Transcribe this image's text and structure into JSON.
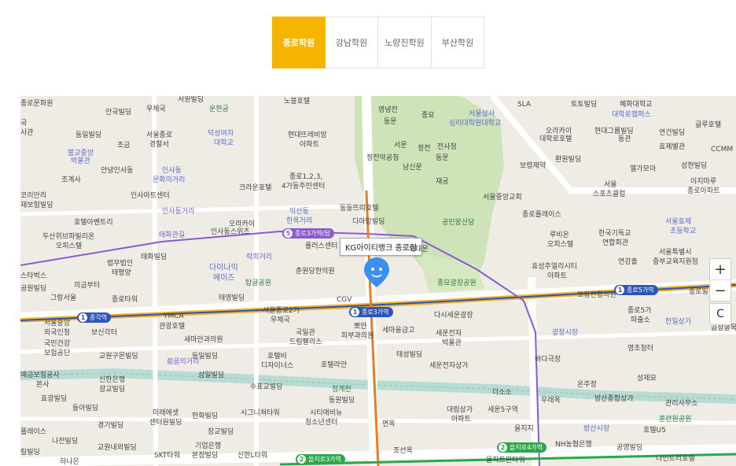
{
  "tabs": [
    {
      "label": "종로학원",
      "active": true
    },
    {
      "label": "강남학원",
      "active": false
    },
    {
      "label": "노량진학원",
      "active": false
    },
    {
      "label": "부산학원",
      "active": false
    }
  ],
  "map": {
    "pin_label": "KG아이티뱅크 종로점",
    "zoom_in": "+",
    "zoom_out": "−",
    "reset": "C",
    "stations": {
      "jonggak": "종각역",
      "jongno3ga": "종로3가역",
      "jongno5ga": "종로5가역",
      "jongno3ga_purple": "종로3가역(탑",
      "euljiro4ga": "을지로4가역",
      "euljiro3ga": "을지로3가역"
    },
    "labels": {
      "l1": "종로문화원",
      "l2": "안국빌딩",
      "l3": "우체국",
      "l4": "서원빌딩",
      "l5": "운현궁",
      "l6": "노블호텔",
      "l7": "영녕전",
      "l8": "동문",
      "l9": "종묘",
      "l10": "서울상사",
      "l11": "심리대학원대학교",
      "l12": "SLA",
      "l13": "토토빌딩",
      "l14": "혜화대학교",
      "l15": "대학로캠퍼스",
      "l16": "국",
      "l17": "사관",
      "l18": "동일빌딩",
      "l19": "조금",
      "l20": "서울종로",
      "l21": "경찰서",
      "l22": "덕성여자",
      "l23": "대학교",
      "l24": "현대뜨레비앙",
      "l25": "아파트",
      "l26": "서문",
      "l27": "정전",
      "l28": "전사청",
      "l29": "정전악공청",
      "l30": "동문",
      "l31": "남신문",
      "l32": "오라카이",
      "l33": "대학로호텔",
      "l34": "현대그룹빌딩",
      "l35": "동관",
      "l36": "연건빌딩",
      "l37": "글루호텔",
      "l38": "효제별관",
      "l39": "CCMM",
      "l40": "불교중앙",
      "l41": "박물관",
      "l42": "조계사",
      "l43": "안녕인사동",
      "l44": "인사동",
      "l45": "문화의거리",
      "l46": "종로1,2,3,",
      "l47": "4가동주민센터",
      "l48": "재궁",
      "l49": "보령제약",
      "l50": "환원빌딩",
      "l51": "엘가모아",
      "l52": "성현빌딩",
      "l53": "코리안리",
      "l54": "재보험빌딩",
      "l55": "인사아트센터",
      "l56": "크라운호텔",
      "l57": "서울",
      "l58": "스포츠클럽",
      "l59": "이지마루",
      "l60": "종로아파트",
      "l61": "인사동거리",
      "l62": "호텔아벤트리",
      "l63": "익선동",
      "l64": "한옥거리",
      "l65": "동동뜨띠호텔",
      "l66": "서울중앙교회",
      "l67": "종로플레이스",
      "l68": "디아망빌딩",
      "l69": "공민왕신당",
      "l70": "두산위브파빌리온",
      "l71": "오피스텔",
      "l72": "태화관길",
      "l73": "오라카이",
      "l74": "인사동스위츠",
      "l75": "루비온",
      "l76": "오피스텔",
      "l77": "한국기독교",
      "l78": "연합회관",
      "l79": "서울효제",
      "l80": "초등학교",
      "l81": "서울특별시",
      "l82": "중부교육지원청",
      "l83": "스타벅스",
      "l84": "태화빌딩",
      "l85": "락희거리",
      "l86": "플러스센터",
      "l87": "외대문",
      "l88": "법무법인",
      "l89": "태평양",
      "l90": "다이나믹",
      "l91": "메이즈",
      "l92": "춘원당한의원",
      "l93": "효성주얼리시티",
      "l94": "아파트",
      "l95": "연강홀",
      "l96": "의금부터",
      "l97": "탑골공원",
      "l98": "종묘광장공원",
      "l99": "공원빌딩",
      "l100": "그랑서울",
      "l101": "종로타워",
      "l102": "태영빌딩",
      "l103": "CGV",
      "l104": "보람연합의원",
      "l105": "종로5가",
      "l106": "파출소",
      "l107": "한일상가",
      "l108": "종로빌딩",
      "l109": "서울중앙",
      "l110": "외국인청",
      "l111": "서울종로2가",
      "l112": "우체국",
      "l113": "YMCA",
      "l114": "관광호텔",
      "l115": "뽀얀",
      "l116": "피부과의원",
      "l117": "세마을금고",
      "l118": "다시세운광장",
      "l119": "광장시장",
      "l120": "곱창골목",
      "l121": "보신각터",
      "l122": "국일관",
      "l123": "드림팰리스",
      "l124": "세운전자",
      "l125": "박물관",
      "l126": "새마안과의원",
      "l127": "국민건강",
      "l128": "보험공단",
      "l129": "교원구몬빌딩",
      "l130": "호텔비",
      "l131": "디자이너스",
      "l132": "호텔라안",
      "l133": "태성빌딩",
      "l134": "세운전자상가",
      "l135": "젊음의거리",
      "l136": "동일빌딩",
      "l137": "바다극장",
      "l138": "영초청터",
      "l139": "예금보험공사",
      "l140": "본사",
      "l141": "신한은행",
      "l142": "광교빌딩",
      "l143": "삼일빌딩",
      "l144": "수표교빌딩",
      "l145": "청계천",
      "l146": "더소소",
      "l147": "온주정",
      "l148": "성제묘",
      "l149": "효광빌딩",
      "l150": "동아빌딩",
      "l151": "동원빌딩",
      "l152": "우래옥",
      "l153": "방산종합상가",
      "l154": "관리사무소",
      "l155": "미래에셋",
      "l156": "센터원빌딩",
      "l157": "한화빌딩",
      "l158": "시그니쳐타워",
      "l159": "시티애비뉴",
      "l160": "청소년센터",
      "l161": "대림상가",
      "l162": "아파트",
      "l163": "세운5구역",
      "l164": "훈련원공원",
      "l165": "플레이스",
      "l166": "경기빌딩",
      "l167": "장교빌딩",
      "l168": "면옥",
      "l169": "을지지",
      "l170": "방산시장",
      "l171": "호텔U5",
      "l172": "나전빌딩",
      "l173": "교원내외빌딩",
      "l174": "기업은행",
      "l175": "본점빌딩",
      "l176": "SKT타워",
      "l177": "신한L타워",
      "l178": "조선옥",
      "l179": "을지로4가역",
      "l180": "NH농협은행",
      "l181": "공영빌딩",
      "l182": "나인트리호텔",
      "l183": "을지트윈타워",
      "l184": "하나은",
      "l185": "림빌딩",
      "l186": "종로5가역"
    }
  }
}
